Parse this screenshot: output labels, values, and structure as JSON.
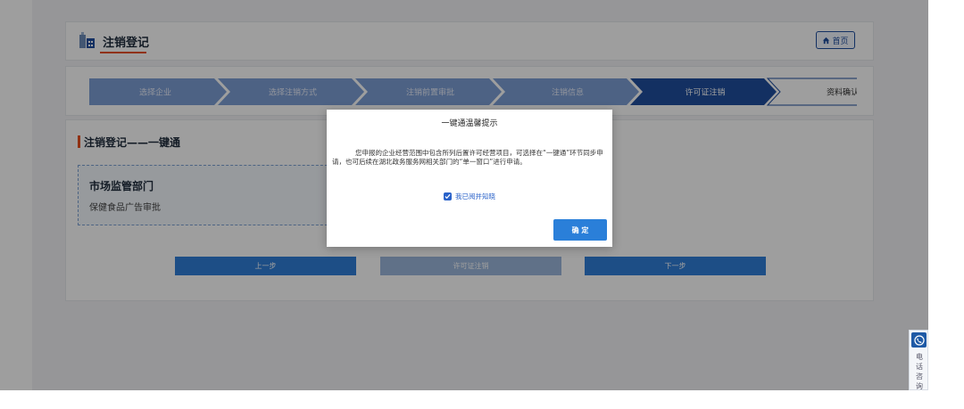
{
  "header": {
    "title": "注销登记",
    "home_label": "首页"
  },
  "steps": [
    {
      "label": "选择企业",
      "state": "done"
    },
    {
      "label": "选择注销方式",
      "state": "done"
    },
    {
      "label": "注销前置审批",
      "state": "done"
    },
    {
      "label": "注销信息",
      "state": "done"
    },
    {
      "label": "许可证注销",
      "state": "active"
    },
    {
      "label": "资料确认",
      "state": "todo"
    }
  ],
  "section": {
    "title": "注销登记——一键通"
  },
  "department": {
    "name": "市场监管部门",
    "item": "保健食品广告审批"
  },
  "buttons": {
    "prev": "上一步",
    "middle": "许可证注销",
    "next": "下一步"
  },
  "dialog": {
    "title": "一键通温馨提示",
    "body": "您申报的企业经营范围中包含所列后置许可经营项目，可选择在“一键通”环节同步申请，也可后续在湖北政务服务网相关部门的“单一窗口”进行申请。",
    "agree_label": "我已阅并知晓",
    "confirm_label": "确 定"
  },
  "consult": {
    "label": "电话咨询"
  },
  "colors": {
    "accent": "#2a7fd9",
    "step_active": "#1f4e9e",
    "step_done": "#7d9fd6",
    "mark": "#e8501e"
  }
}
